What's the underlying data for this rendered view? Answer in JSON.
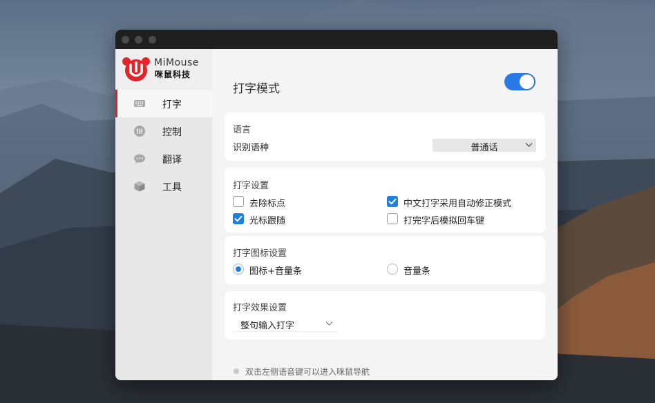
{
  "app": {
    "brand_en": "MiMouse",
    "brand_cn": "咪鼠科技",
    "accent_color": "#2979e6",
    "active_indicator_color": "#e02424"
  },
  "sidebar": {
    "items": [
      {
        "label": "打字",
        "icon": "keyboard-icon",
        "active": true
      },
      {
        "label": "控制",
        "icon": "sliders-icon",
        "active": false
      },
      {
        "label": "翻译",
        "icon": "chat-bubble-icon",
        "active": false
      },
      {
        "label": "工具",
        "icon": "cube-icon",
        "active": false
      }
    ]
  },
  "main": {
    "title": "打字模式",
    "toggle_on": true,
    "language_card": {
      "title": "语言",
      "row_label": "识别语种",
      "selected": "普通话"
    },
    "typing_settings": {
      "title": "打字设置",
      "options": [
        {
          "label": "去除标点",
          "checked": false
        },
        {
          "label": "中文打字采用自动修正模式",
          "checked": true
        },
        {
          "label": "光标跟随",
          "checked": true
        },
        {
          "label": "打完字后模拟回车键",
          "checked": false
        }
      ]
    },
    "icon_settings": {
      "title": "打字图标设置",
      "options": [
        {
          "label": "图标+音量条",
          "selected": true
        },
        {
          "label": "音量条",
          "selected": false
        }
      ]
    },
    "effect_settings": {
      "title": "打字效果设置",
      "selected": "整句输入打字"
    },
    "footer_hint": "双击左侧语音键可以进入咪鼠导航"
  }
}
